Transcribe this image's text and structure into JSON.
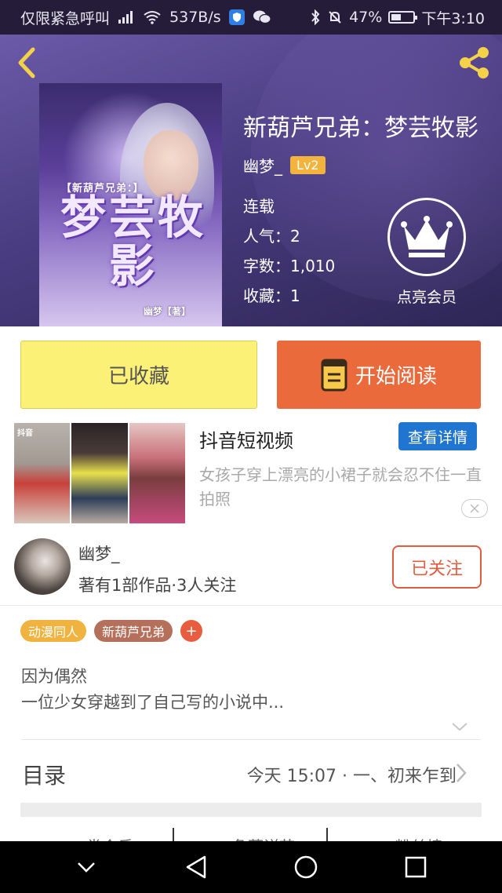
{
  "status_bar": {
    "carrier": "仅限紧急呼叫",
    "net_speed": "537B/s",
    "battery_percent": "47%",
    "battery_level": 0.47,
    "time": "下午3:10",
    "icons": [
      "signal-icon",
      "wifi-icon",
      "shield-app-icon",
      "wechat-icon",
      "bluetooth-icon",
      "mute-bell-icon",
      "battery-icon"
    ]
  },
  "header": {
    "back_icon": "back-arrow-icon",
    "share_icon": "share-icon",
    "cover": {
      "series": "【新葫芦兄弟：】",
      "title": "梦芸牧影",
      "author": "幽梦【著】"
    },
    "book_title": "新葫芦兄弟：梦芸牧影",
    "author_name": "幽梦_",
    "author_level": "Lv2",
    "status": "连载",
    "popularity": "人气：2",
    "word_count": "字数：1,010",
    "favorites": "收藏：1",
    "vip_label": "点亮会员",
    "vip_icon": "crown-icon"
  },
  "actions": {
    "collected_label": "已收藏",
    "read_label": "开始阅读",
    "read_icon": "book-icon"
  },
  "ad": {
    "thumb_tag": "抖音",
    "title": "抖音短视频",
    "detail_button": "查看详情",
    "description": "女孩子穿上漂亮的小裙子就会忍不住一直拍照",
    "close_icon": "close-icon"
  },
  "author_section": {
    "name": "幽梦_",
    "stats": "著有1部作品·3人关注",
    "follow_label": "已关注"
  },
  "tags": [
    {
      "label": "动漫同人",
      "color": "#f0b33f"
    },
    {
      "label": "新葫芦兄弟",
      "color": "#b5705b"
    }
  ],
  "add_tag_label": "+",
  "intro": {
    "line1": "因为偶然",
    "line2": "一位少女穿越到了自己写的小说中..."
  },
  "toc": {
    "title": "目录",
    "latest": "今天 15:07 · 一、初来乍到"
  },
  "tabs_peek": [
    "类会反",
    "角蕃详节",
    "粉丝榜"
  ],
  "colors": {
    "accent_orange": "#ea6a3c",
    "collected_yellow": "#fbf176",
    "header_purple": "#4a3d82",
    "ad_blue": "#1f75cf",
    "follow_red": "#e05d42"
  }
}
